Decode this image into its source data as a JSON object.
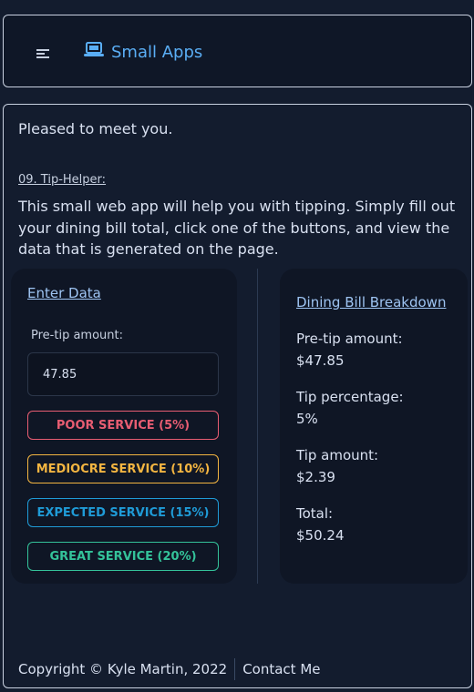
{
  "header": {
    "menu_icon": "hamburger-menu-icon",
    "brand_icon": "laptop-icon",
    "brand_name": "Small Apps",
    "accent_color": "#5aaef5"
  },
  "main": {
    "greeting": "Pleased to meet you.",
    "app_title": "09. Tip-Helper:",
    "description": "This small web app will help you with tipping. Simply fill out your dining bill total, click one of the buttons, and view the data that is generated on the page."
  },
  "form": {
    "heading": "Enter Data",
    "pretip_label": "Pre-tip amount:",
    "pretip_value": "47.85",
    "buttons": [
      {
        "label": "POOR SERVICE (5%)",
        "color": "#e85d72"
      },
      {
        "label": "MEDIOCRE SERVICE (10%)",
        "color": "#f3b541"
      },
      {
        "label": "EXPECTED SERVICE (15%)",
        "color": "#1f9bd7"
      },
      {
        "label": "GREAT SERVICE (20%)",
        "color": "#34c39a"
      }
    ]
  },
  "breakdown": {
    "heading": "Dining Bill Breakdown",
    "items": [
      {
        "label": "Pre-tip amount:",
        "value": "$47.85"
      },
      {
        "label": "Tip percentage:",
        "value": "5%"
      },
      {
        "label": "Tip amount:",
        "value": "$2.39"
      },
      {
        "label": "Total:",
        "value": "$50.24"
      }
    ]
  },
  "footer": {
    "copyright": "Copyright © Kyle Martin, 2022",
    "contact": "Contact Me"
  }
}
